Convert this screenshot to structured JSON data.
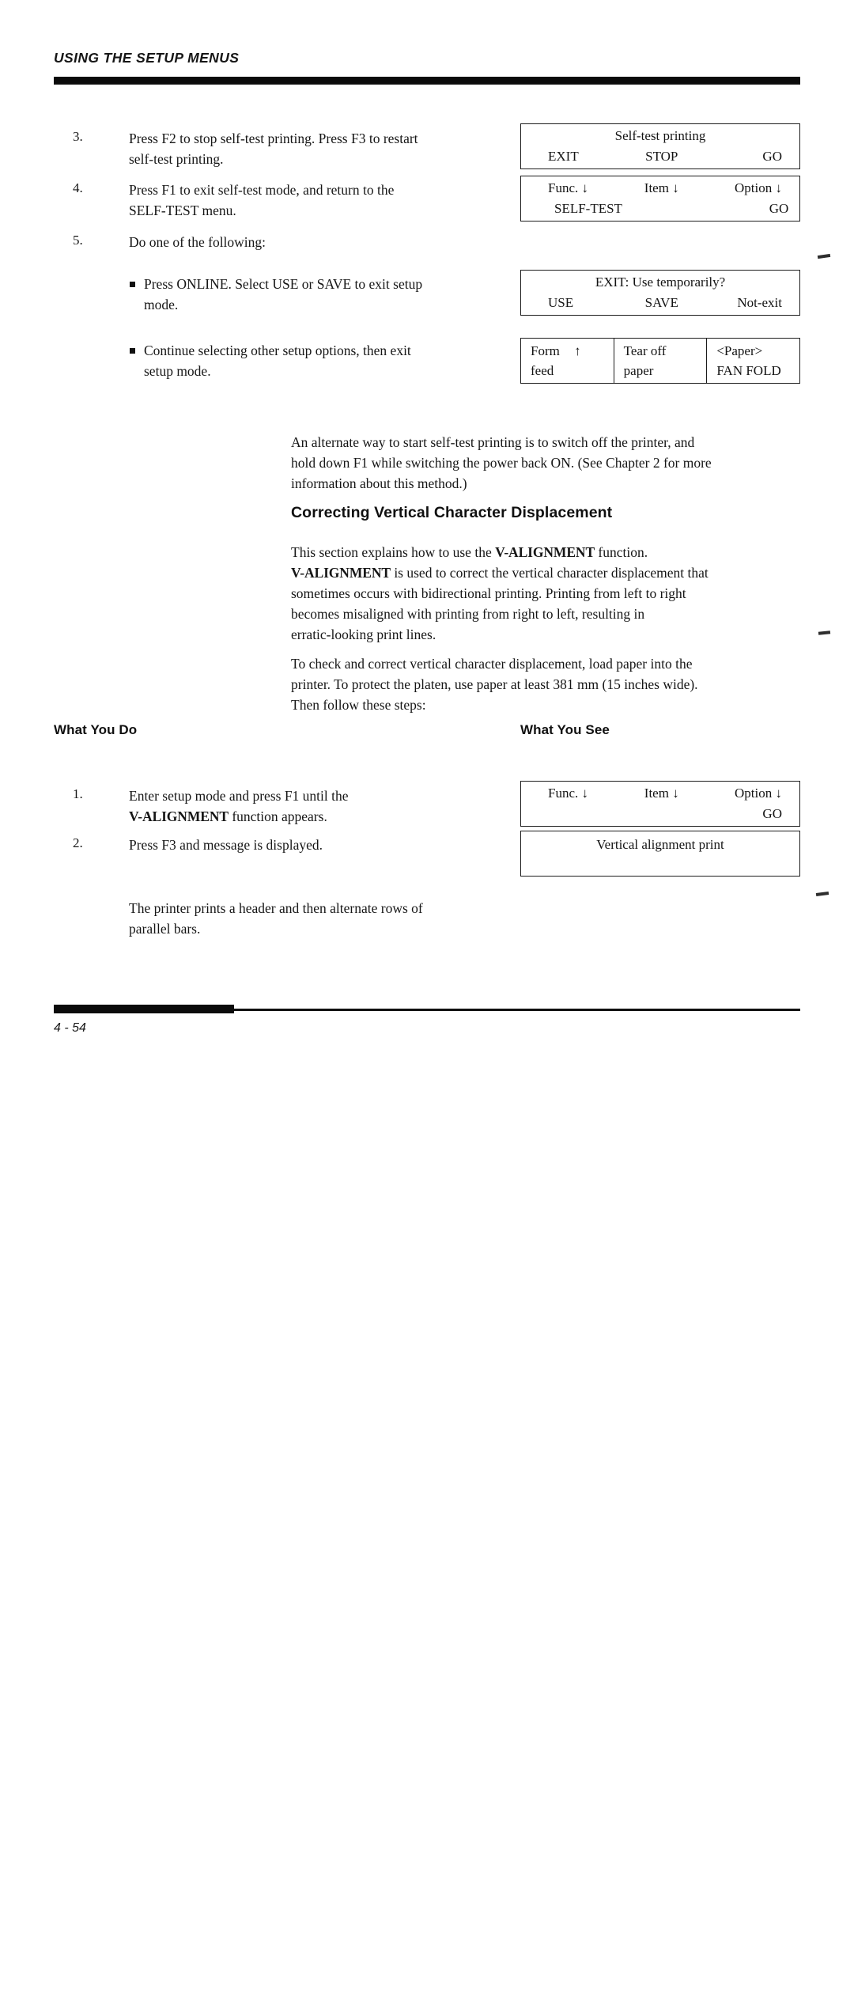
{
  "header": {
    "running_head": "USING THE SETUP MENUS"
  },
  "steps_top": [
    {
      "number": "3.",
      "lines": [
        "Press F2 to stop self-test printing.  Press F3 to restart",
        "self-test printing."
      ]
    },
    {
      "number": "4.",
      "lines": [
        "Press F1 to exit self-test mode, and return to the",
        "SELF-TEST menu."
      ]
    },
    {
      "number": "5.",
      "lines": [
        "Do one of the following:"
      ]
    }
  ],
  "bullets": [
    {
      "lines": [
        "Press ONLINE.  Select USE or SAVE to exit setup",
        "mode."
      ]
    },
    {
      "lines": [
        "Continue selecting other setup options, then exit",
        "setup mode."
      ]
    }
  ],
  "lcd_panels": [
    {
      "id": "self-test-printing",
      "title": "Self-test printing",
      "left": "EXIT",
      "middle": "STOP",
      "right": "GO"
    },
    {
      "id": "self-test-menu",
      "header_left": "Func.",
      "header_mid": "Item",
      "header_right": "Option",
      "arrow": "↓",
      "value_left": "SELF-TEST",
      "value_right": "GO"
    },
    {
      "id": "exit-use-temporarily",
      "title": "EXIT: Use temporarily?",
      "left": "USE",
      "middle": "SAVE",
      "right": "Not-exit"
    },
    {
      "id": "paper-controls",
      "cells": [
        {
          "line1": "Form",
          "arrow": "↑",
          "line2": "feed"
        },
        {
          "line1": "Tear off",
          "arrow": "",
          "line2": "paper"
        },
        {
          "line1": "<Paper>",
          "arrow": "",
          "line2": "FAN FOLD"
        }
      ]
    },
    {
      "id": "v-alignment-menu",
      "header_left": "Func.",
      "header_mid": "Item",
      "header_right": "Option",
      "arrow": "↓",
      "value_left": "",
      "value_right": "GO"
    },
    {
      "id": "vertical-alignment-print",
      "title": "Vertical alignment print"
    }
  ],
  "note_paragraph": {
    "lines": [
      "An alternate way to start self-test printing is to switch off the printer, and",
      "hold down F1 while switching the power back ON.  (See Chapter 2 for more",
      "information about this method.)"
    ]
  },
  "section": {
    "heading": "Correcting Vertical Character Displacement",
    "paragraph1": {
      "line1_pre": "This section explains how to use the ",
      "line1_bold": "V-ALIGNMENT",
      "line1_post": " function.",
      "line2_bold": "V-ALIGNMENT",
      "line2_post": " is used to correct the vertical character displacement that",
      "line3": "sometimes occurs with bidirectional printing.  Printing from left to right",
      "line4": "becomes misaligned with printing from right to left, resulting in",
      "line5": "erratic-looking print lines."
    },
    "paragraph2": {
      "line1": "To check and correct vertical character displacement, load paper into the",
      "line2": "printer.  To protect the platen, use paper at least 381 mm (15 inches wide).",
      "line3": "Then follow these steps:"
    }
  },
  "columns": {
    "what_you_do": "What You Do",
    "what_you_see": "What You See"
  },
  "steps_bottom": [
    {
      "number": "1.",
      "line1": "Enter setup mode and press F1 until the",
      "line2_bold": "V-ALIGNMENT",
      "line2_post": " function appears."
    },
    {
      "number": "2.",
      "line1": "Press F3 and  message is displayed."
    }
  ],
  "closing_paragraph": {
    "lines": [
      "The printer prints a header and then alternate rows of",
      "parallel bars."
    ]
  },
  "footer": {
    "folio": "4 - 54"
  }
}
